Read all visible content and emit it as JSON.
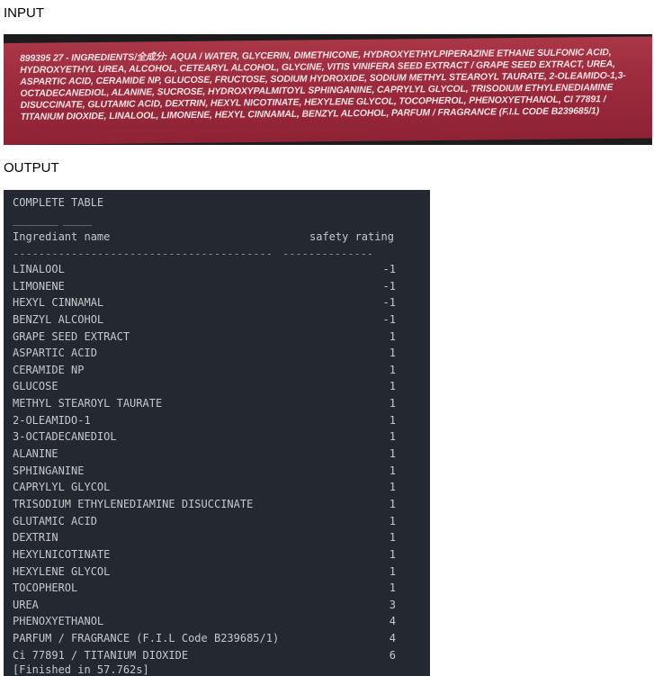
{
  "input_heading": "INPUT",
  "output_heading": "OUTPUT",
  "product_label_text": "899395 27 - INGREDIENTS/全成分: AQUA / WATER, GLYCERIN, DIMETHICONE, HYDROXYETHYLPIPERAZINE ETHANE SULFONIC ACID, HYDROXYETHYL UREA, ALCOHOL, CETEARYL ALCOHOL, GLYCINE, VITIS VINIFERA SEED EXTRACT / GRAPE SEED EXTRACT, UREA, ASPARTIC ACID, CERAMIDE NP, GLUCOSE, FRUCTOSE, SODIUM HYDROXIDE, SODIUM METHYL STEAROYL TAURATE, 2-OLEAMIDO-1,3-OCTADECANEDIOL, ALANINE, SUCROSE, HYDROXYPALMITOYL SPHINGANINE, CAPRYLYL GLYCOL, TRISODIUM ETHYLENEDIAMINE DISUCCINATE, GLUTAMIC ACID, DEXTRIN, HEXYL NICOTINATE, HEXYLENE GLYCOL, TOCOPHEROL, PHENOXYETHANOL, CI 77891 / TITANIUM DIOXIDE, LINALOOL, LIMONENE, HEXYL CINNAMAL, BENZYL ALCOHOL, PARFUM / FRAGRANCE (F.I.L Code B239685/1)",
  "terminal": {
    "title": "COMPLETE TABLE",
    "title_underline": "________ _____",
    "col_name": "Ingrediant name",
    "col_rating": "safety rating",
    "dashes_name": "----------------------------------------",
    "dashes_rating": "--------------",
    "finished": "[Finished in 57.762s]"
  },
  "rows": [
    {
      "name": "LINALOOL",
      "rating": "-1"
    },
    {
      "name": "LIMONENE",
      "rating": "-1"
    },
    {
      "name": "HEXYL CINNAMAL",
      "rating": "-1"
    },
    {
      "name": "BENZYL ALCOHOL",
      "rating": "-1"
    },
    {
      "name": "GRAPE SEED EXTRACT",
      "rating": "1"
    },
    {
      "name": "ASPARTIC ACID",
      "rating": "1"
    },
    {
      "name": "CERAMIDE NP",
      "rating": "1"
    },
    {
      "name": "GLUCOSE",
      "rating": "1"
    },
    {
      "name": "METHYL STEAROYL TAURATE",
      "rating": "1"
    },
    {
      "name": "2-OLEAMIDO-1",
      "rating": "1"
    },
    {
      "name": "3-OCTADECANEDIOL",
      "rating": "1"
    },
    {
      "name": "ALANINE",
      "rating": "1"
    },
    {
      "name": "SPHINGANINE",
      "rating": "1"
    },
    {
      "name": "CAPRYLYL GLYCOL",
      "rating": "1"
    },
    {
      "name": "TRISODIUM ETHYLENEDIAMINE DISUCCINATE",
      "rating": "1"
    },
    {
      "name": "GLUTAMIC ACID",
      "rating": "1"
    },
    {
      "name": "DEXTRIN",
      "rating": "1"
    },
    {
      "name": "HEXYLNICOTINATE",
      "rating": "1"
    },
    {
      "name": "HEXYLENE GLYCOL",
      "rating": "1"
    },
    {
      "name": "TOCOPHEROL",
      "rating": "1"
    },
    {
      "name": "UREA",
      "rating": "3"
    },
    {
      "name": "PHENOXYETHANOL",
      "rating": "4"
    },
    {
      "name": "PARFUM / FRAGRANCE (F.I.L Code B239685/1)",
      "rating": "4"
    },
    {
      "name": "Ci 77891 / TITANIUM DIOXIDE",
      "rating": "6"
    }
  ]
}
